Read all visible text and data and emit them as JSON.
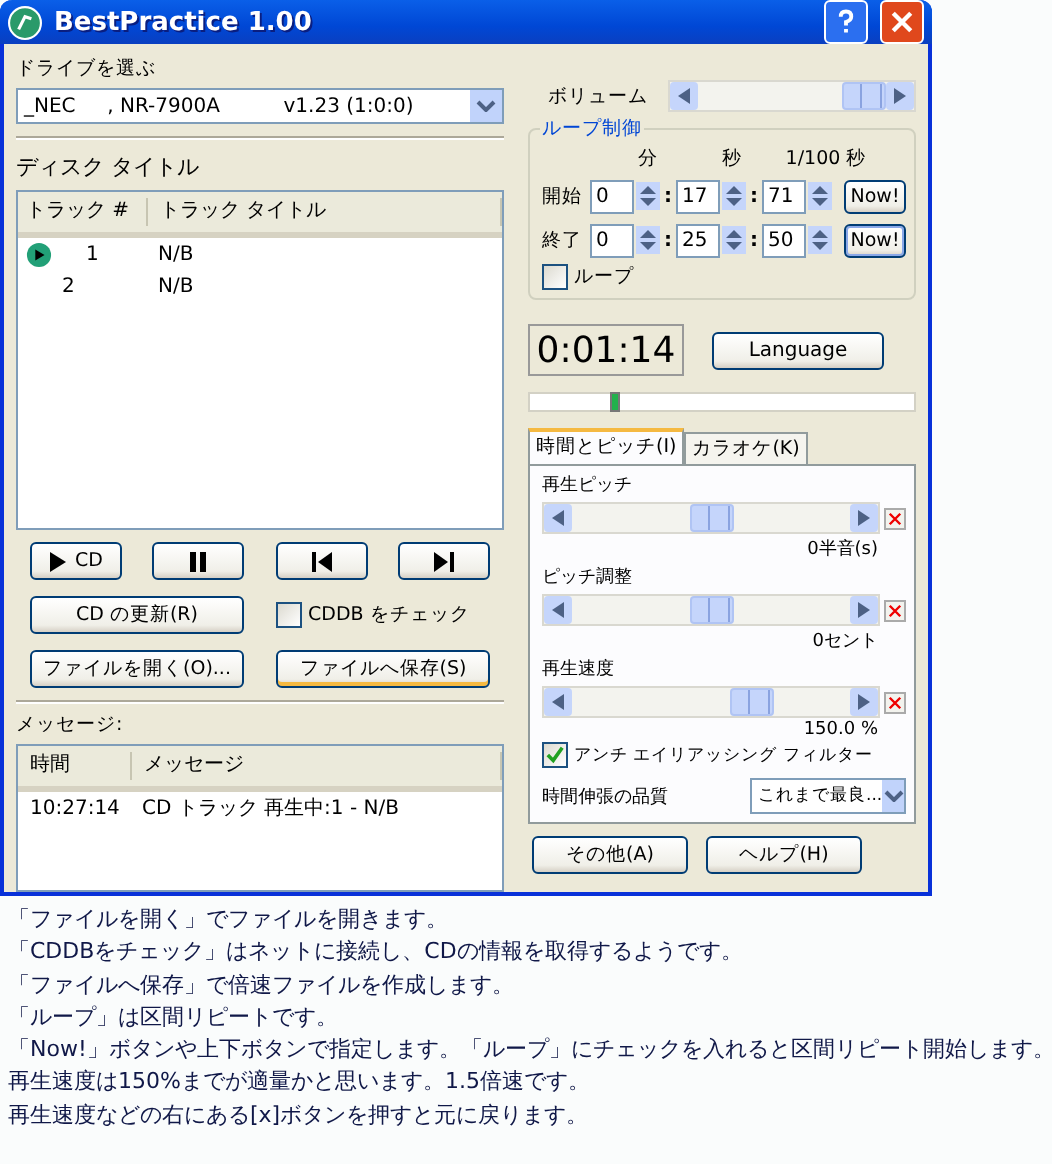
{
  "window": {
    "title": "BestPractice 1.00"
  },
  "drive": {
    "label": "ドライブを選ぶ",
    "value": "_NEC     , NR-7900A          v1.23 (1:0:0)"
  },
  "disc": {
    "label": "ディスク タイトル",
    "columns": [
      "トラック #",
      "トラック タイトル"
    ],
    "rows": [
      {
        "number": "1",
        "title": "N/B",
        "playing": true
      },
      {
        "number": "2",
        "title": "N/B",
        "playing": false
      }
    ]
  },
  "transport": [
    {
      "kind": "play",
      "label": "CD"
    },
    {
      "kind": "pause"
    },
    {
      "kind": "prev"
    },
    {
      "kind": "next"
    }
  ],
  "cd_update": "CD の更新(R)",
  "cddb": {
    "label": "CDDB をチェック",
    "checked": false
  },
  "open_button": "ファイルを開く(O)...",
  "save_button": {
    "label": "ファイルへ保存(S)",
    "default": true
  },
  "messages": {
    "label": "メッセージ:",
    "columns": [
      "時間",
      "メッセージ"
    ],
    "rows": [
      {
        "time": "10:27:14",
        "text": "CD トラック 再生中:1 - N/B"
      }
    ]
  },
  "volume": {
    "label": "ボリューム",
    "level": 0.88
  },
  "loop": {
    "title": "ループ制御",
    "separator": ":",
    "units": [
      "分",
      "秒",
      "1/100 秒"
    ],
    "rows": [
      {
        "label": "開始",
        "values": [
          "0",
          "17",
          "71"
        ],
        "button": "Now!",
        "focused": false
      },
      {
        "label": "終了",
        "values": [
          "0",
          "25",
          "50"
        ],
        "button": "Now!",
        "focused": true
      }
    ],
    "checkbox": {
      "label": "ループ",
      "checked": false
    }
  },
  "time": "0:01:14",
  "language_button": "Language",
  "position": {
    "level": 0.22
  },
  "tabs": [
    {
      "label": "時間とピッチ(I)",
      "selected": true
    },
    {
      "label": "カラオケ(K)",
      "selected": false
    }
  ],
  "sliders": [
    {
      "label": "再生ピッチ",
      "level": 0.5,
      "reading": "0半音(s)"
    },
    {
      "label": "ピッチ調整",
      "level": 0.5,
      "reading": "0セント"
    },
    {
      "label": "再生速度",
      "level": 0.65,
      "reading": "150.0 %"
    }
  ],
  "antialias": {
    "label": "アンチ エイリアッシング フィルター",
    "checked": true
  },
  "quality": {
    "label": "時間伸張の品質",
    "value": "これまで最良..."
  },
  "bottom_buttons": [
    "その他(A)",
    "ヘルプ(H)"
  ],
  "notes": [
    "「ファイルを開く」でファイルを開きます。",
    "「CDDBをチェック」はネットに接続し、CDの情報を取得するようです。",
    "「ファイルへ保存」で倍速ファイルを作成します。",
    "「ループ」は区間リピートです。",
    "「Now!」ボタンや上下ボタンで指定します。「ループ」にチェックを入れると区間リピート開始します。",
    "再生速度は150%までが適量かと思います。1.5倍速です。",
    "再生速度などの右にある[x]ボタンを押すと元に戻ります。"
  ]
}
